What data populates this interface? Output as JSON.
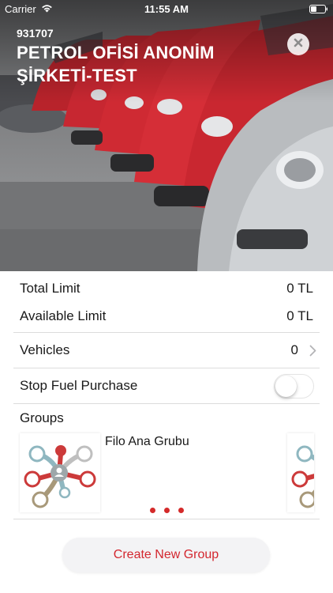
{
  "status_bar": {
    "carrier": "Carrier",
    "time": "11:55 AM"
  },
  "header": {
    "account_number": "931707",
    "account_name": "PETROL OFİSİ ANONİM ŞİRKETİ-TEST"
  },
  "limits": {
    "total_limit_label": "Total Limit",
    "total_limit_value": "0 TL",
    "available_limit_label": "Available Limit",
    "available_limit_value": "0 TL"
  },
  "vehicles": {
    "label": "Vehicles",
    "count": "0"
  },
  "stop_fuel": {
    "label": "Stop Fuel Purchase",
    "enabled": false
  },
  "groups": {
    "title": "Groups",
    "items": [
      {
        "name": "Filo Ana Grubu"
      }
    ],
    "page_count": 3
  },
  "create_group_button": "Create New Group",
  "colors": {
    "accent": "#d3262e",
    "dot": "#d42a2a"
  }
}
